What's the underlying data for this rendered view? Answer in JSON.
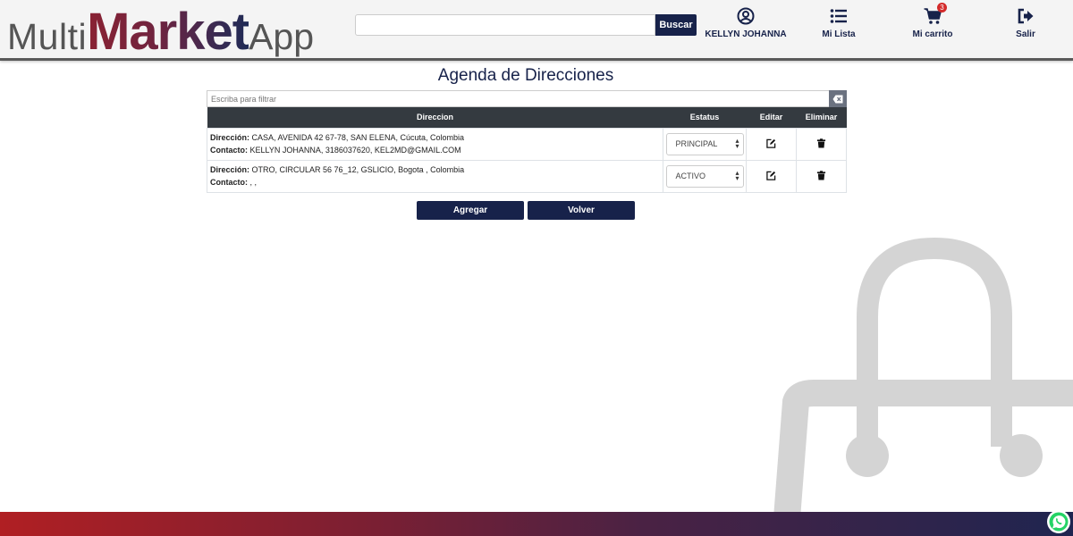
{
  "header": {
    "logo": {
      "part1": "Multi",
      "part2": "Market",
      "part3": "App"
    },
    "search": {
      "placeholder": "",
      "button_label": "Buscar"
    },
    "nav": {
      "user": {
        "label": "KELLYN JOHANNA",
        "icon": "user-circle-icon"
      },
      "list": {
        "label": "Mi Lista",
        "icon": "list-icon"
      },
      "cart": {
        "label": "Mi carrito",
        "icon": "cart-icon",
        "badge": "3"
      },
      "exit": {
        "label": "Salir",
        "icon": "sign-out-icon"
      }
    }
  },
  "main": {
    "title": "Agenda de Direcciones",
    "filter": {
      "placeholder": "Escriba para filtrar"
    },
    "table": {
      "headers": [
        "Direccion",
        "Estatus",
        "Editar",
        "Eliminar"
      ],
      "rows": [
        {
          "dir_label": "Dirección:",
          "dir_value": "CASA, AVENIDA 42 67-78, SAN ELENA, Cúcuta, Colombia",
          "contact_label": "Contacto:",
          "contact_value": "KELLYN JOHANNA, 3186037620, KEL2MD@GMAIL.COM",
          "status": "PRINCIPAL"
        },
        {
          "dir_label": "Dirección:",
          "dir_value": "OTRO, CIRCULAR 56 76_12, GSLICIO, Bogota , Colombia",
          "contact_label": "Contacto:",
          "contact_value": ", ,",
          "status": "ACTIVO"
        }
      ]
    },
    "buttons": {
      "add": "Agregar",
      "back": "Volver"
    }
  },
  "colors": {
    "navy": "#17224a",
    "table_header": "#343a40",
    "footer_start": "#b01f23",
    "footer_end": "#1f2550",
    "bag_gray": "#d4d4d4"
  }
}
